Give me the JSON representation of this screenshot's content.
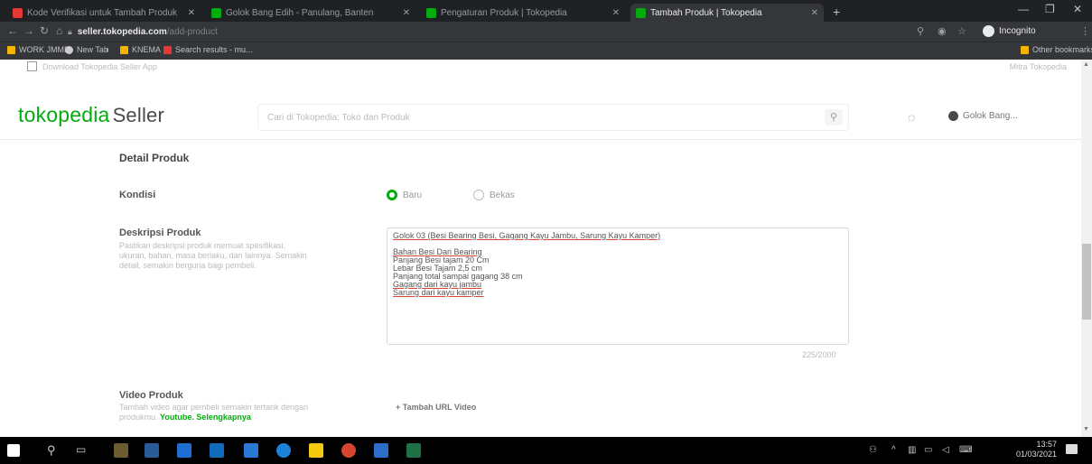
{
  "browser": {
    "tabs": [
      {
        "title": "Kode Verifikasi untuk Tambah Produk",
        "favicon_color": "#e53935"
      },
      {
        "title": "Golok Bang Edih - Panulang, Banten",
        "favicon_color": "#03ac0e"
      },
      {
        "title": "Pengaturan Produk | Tokopedia",
        "favicon_color": "#03ac0e"
      },
      {
        "title": "Tambah Produk | Tokopedia",
        "favicon_color": "#03ac0e",
        "active": true
      }
    ],
    "new_tab": "+",
    "address": {
      "host": "seller.tokopedia.com",
      "path": "/add-product"
    },
    "profile_label": "Incognito",
    "bookmarks": [
      "WORK JMMB",
      "New Tab",
      "KNEMA",
      "Search results - mu..."
    ],
    "other_bookmarks": "Other bookmarks"
  },
  "header": {
    "top_notice": "Download Tokopedia Seller App",
    "mitra_link": "Mitra Tokopedia",
    "logo_brand": "tokopedia",
    "logo_suffix": "Seller",
    "search_placeholder": "Cari di Tokopedia: Toko dan Produk",
    "user_name": "Golok Bang..."
  },
  "form": {
    "section_title": "Detail Produk",
    "kondisi_label": "Kondisi",
    "kondisi_options": [
      "Baru",
      "Bekas"
    ],
    "kondisi_selected": "Baru",
    "deskripsi_label": "Deskripsi Produk",
    "deskripsi_help": "Pastikan deskripsi produk memuat spesifikasi, ukuran, bahan, masa berlaku, dan lainnya. Semakin detail, semakin berguna bagi pembeli.",
    "deskripsi_lines": [
      "Golok 03 (Besi Bearing Besi, Gagang Kayu Jambu, Sarung Kayu Kamper)",
      "",
      "Bahan Besi Dari Bearing",
      "Panjang Besi tajam 20 Cm",
      "Lebar Besi Tajam 2,5 cm",
      "Panjang total sampai gagang 38 cm",
      "Gagang dari kayu jambu",
      "Sarung dari kayu kamper"
    ],
    "char_counter": "225/2000",
    "video_label": "Video Produk",
    "video_help": "Tambah video agar pembeli semakin tertarik dengan produkmu.",
    "video_help_link": "Youtube. Selengkapnya",
    "add_video_button": "+ Tambah URL Video"
  },
  "taskbar": {
    "time": "13:57",
    "date": "01/03/2021"
  }
}
